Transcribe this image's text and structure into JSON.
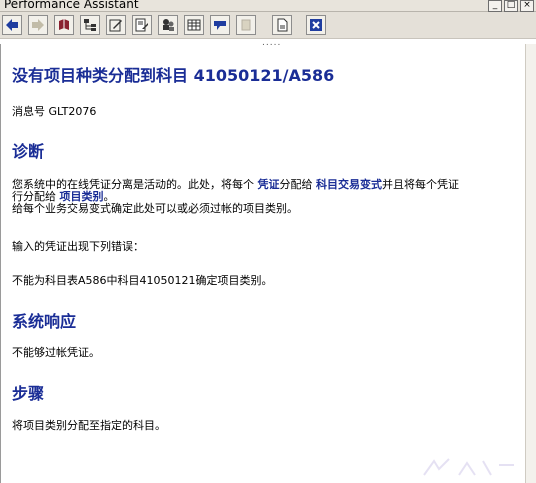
{
  "window": {
    "title": "Performance Assistant",
    "min": "_",
    "max": "□",
    "close": "×"
  },
  "toolbar": {
    "grip": "....."
  },
  "doc": {
    "heading": "没有项目种类分配到科目  41050121/A586",
    "msg_label": "消息号",
    "msg_no": "GLT2076",
    "diag_title": "诊断",
    "diag_p1_a": "您系统中的在线凭证分离是活动的。此处，将每个 ",
    "link_voucher": "凭证",
    "diag_p1_b": "分配给 ",
    "link_variant": "科目交易变式",
    "diag_p1_c": "并且将每个凭证",
    "diag_p1_d": "行分配给 ",
    "link_item_cat": "项目类别",
    "diag_p1_e": "。",
    "diag_p2": "给每个业务交易变式确定此处可以或必须过帐的项目类别。",
    "diag_p3": "输入的凭证出现下列错误：",
    "diag_p4": "不能为科目表A586中科目41050121确定项目类别。",
    "resp_title": "系统响应",
    "resp_p": "不能够过帐凭证。",
    "proc_title": "步骤",
    "proc_p": "将项目类别分配至指定的科目。"
  }
}
